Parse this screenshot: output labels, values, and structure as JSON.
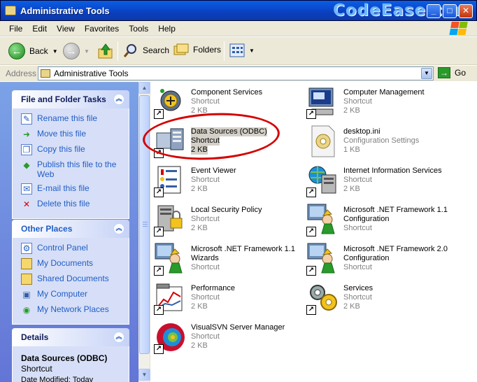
{
  "window": {
    "title": "Administrative Tools",
    "watermark": "CodeEase.com"
  },
  "menu": [
    "File",
    "Edit",
    "View",
    "Favorites",
    "Tools",
    "Help"
  ],
  "toolbar": {
    "back": "Back",
    "search": "Search",
    "folders": "Folders"
  },
  "address": {
    "label": "Address",
    "value": "Administrative Tools",
    "go": "Go"
  },
  "tasks_panel": {
    "title": "File and Folder Tasks",
    "items": [
      "Rename this file",
      "Move this file",
      "Copy this file",
      "Publish this file to the Web",
      "E-mail this file",
      "Delete this file"
    ]
  },
  "places_panel": {
    "title": "Other Places",
    "items": [
      "Control Panel",
      "My Documents",
      "Shared Documents",
      "My Computer",
      "My Network Places"
    ]
  },
  "details_panel": {
    "title": "Details",
    "name": "Data Sources (ODBC)",
    "type": "Shortcut",
    "date": "Date Modified: Today"
  },
  "files": [
    {
      "name": "Component Services",
      "line2": "Shortcut",
      "line3": "2 KB",
      "icon": "component-services-icon"
    },
    {
      "name": "Computer Management",
      "line2": "Shortcut",
      "line3": "2 KB",
      "icon": "computer-management-icon"
    },
    {
      "name": "Data Sources (ODBC)",
      "line2": "Shortcut",
      "line3": "2 KB",
      "icon": "data-sources-icon"
    },
    {
      "name": "desktop.ini",
      "line2": "Configuration Settings",
      "line3": "1 KB",
      "icon": "config-file-icon"
    },
    {
      "name": "Event Viewer",
      "line2": "Shortcut",
      "line3": "2 KB",
      "icon": "event-viewer-icon"
    },
    {
      "name": "Internet Information Services",
      "line2": "Shortcut",
      "line3": "2 KB",
      "icon": "iis-icon"
    },
    {
      "name": "Local Security Policy",
      "line2": "Shortcut",
      "line3": "2 KB",
      "icon": "security-policy-icon"
    },
    {
      "name": "Microsoft .NET Framework 1.1",
      "name2": "Configuration",
      "line2": "Shortcut",
      "icon": "dotnet-config-icon"
    },
    {
      "name": "Microsoft .NET Framework 1.1",
      "name2": "Wizards",
      "line2": "Shortcut",
      "icon": "dotnet-wizards-icon"
    },
    {
      "name": "Microsoft .NET Framework 2.0",
      "name2": "Configuration",
      "line2": "Shortcut",
      "icon": "dotnet2-config-icon"
    },
    {
      "name": "Performance",
      "line2": "Shortcut",
      "line3": "2 KB",
      "icon": "performance-icon"
    },
    {
      "name": "Services",
      "line2": "Shortcut",
      "line3": "2 KB",
      "icon": "services-icon"
    },
    {
      "name": "VisualSVN Server Manager",
      "line2": "Shortcut",
      "line3": "2 KB",
      "icon": "visualsvn-icon"
    }
  ]
}
